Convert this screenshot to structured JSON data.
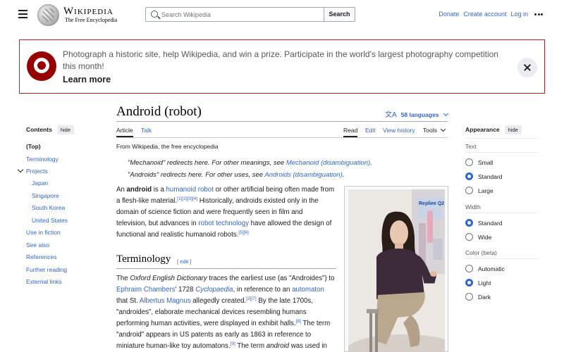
{
  "header": {
    "wordmark": "Wikipedia",
    "tagline": "The Free Encyclopedia",
    "search_placeholder": "Search Wikipedia",
    "search_button": "Search",
    "links": [
      "Donate",
      "Create account",
      "Log in"
    ]
  },
  "banner": {
    "text": "Photograph a historic site, help Wikipedia, and win a prize. Participate in the world's largest photography competition this month!",
    "cta": "Learn more"
  },
  "toc": {
    "title": "Contents",
    "hide": "hide",
    "items": [
      "(Top)",
      "Terminology",
      "Projects",
      "Japan",
      "Singapore",
      "South Korea",
      "United States",
      "Use in fiction",
      "See also",
      "References",
      "Further reading",
      "External links"
    ]
  },
  "article": {
    "title": "Android (robot)",
    "languages": "58 languages",
    "tabs_left": [
      "Article",
      "Talk"
    ],
    "tabs_right": [
      "Read",
      "Edit",
      "View history",
      "Tools"
    ],
    "from": "From Wikipedia, the free encyclopedia",
    "hatnote1_pre": "\"Mechanoid\" redirects here. For other meanings, see ",
    "hatnote1_link": "Mechanoid (disambiguation)",
    "hatnote2_pre": "\"Androids\" redirects here. For other uses, see ",
    "hatnote2_link": "Androids (disambiguation)",
    "intro": {
      "p1": "An ",
      "bold": "android",
      "p2": " is a ",
      "link1": "humanoid robot",
      "p3": " or other artificial being often made from a flesh-like material.",
      "ref1": "[1][2][3][4]",
      "p4": " Historically, androids existed only in the domain of science fiction and were frequently seen in film and television, but advances in ",
      "link2": "robot technology",
      "p5": " have allowed the design of functional and realistic humanoid robots.",
      "ref2": "[5][6]"
    },
    "section_title": "Terminology",
    "edit": "edit",
    "term": {
      "t1": "The ",
      "oed": "Oxford English Dictionary",
      "t2": " traces the earliest use (as \"Androides\") to ",
      "link_chambers": "Ephraim Chambers",
      "t3": "' 1728 ",
      "link_cyclo": "Cyclopaedia",
      "t4": ", in reference to an ",
      "link_automaton": "automaton",
      "t5": " that St. ",
      "link_albertus": "Albertus Magnus",
      "t6": " allegedly created.",
      "ref3": "[3][7]",
      "t7": " By the late 1700s, \"androides\", elaborate mechanical devices resembling humans performing human activities, were displayed in exhibit halls.",
      "ref4": "[8]",
      "t8": " The term \"android\" appears in US patents as early as 1863 in reference to miniature human-like toy automatons.",
      "ref5": "[9]",
      "t9": " The term ",
      "android_it": "android",
      "t10": " was used in"
    },
    "photo_sign": "Repliee Q2"
  },
  "appearance": {
    "title": "Appearance",
    "hide": "hide",
    "text_label": "Text",
    "text_options": [
      "Small",
      "Standard",
      "Large"
    ],
    "width_label": "Width",
    "width_options": [
      "Standard",
      "Wide"
    ],
    "color_label": "Color (beta)",
    "color_options": [
      "Automatic",
      "Light",
      "Dark"
    ]
  },
  "colors": {
    "link": "#3366cc",
    "banner_border": "#b32424",
    "banner_logo": "#970302",
    "radio_on": "#3366cc"
  }
}
